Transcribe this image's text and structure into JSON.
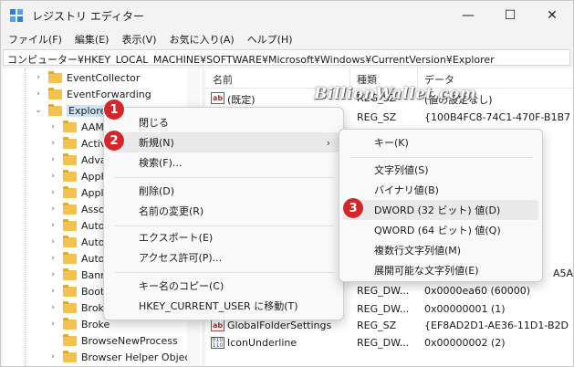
{
  "window": {
    "title": "レジストリ エディター",
    "controls": {
      "minimize": "—",
      "maximize": "☐",
      "close": "✕"
    }
  },
  "menubar": [
    "ファイル(F)",
    "編集(E)",
    "表示(V)",
    "お気に入り(A)",
    "ヘルプ(H)"
  ],
  "address": "コンピューター¥HKEY_LOCAL_MACHINE¥SOFTWARE¥Microsoft¥Windows¥CurrentVersion¥Explorer",
  "tree": {
    "items": [
      {
        "label": "EventCollector",
        "expanded": false,
        "selected": false
      },
      {
        "label": "EventForwarding",
        "expanded": false,
        "selected": false
      },
      {
        "label": "Explorer",
        "expanded": true,
        "selected": true
      },
      {
        "label": "AAM",
        "expanded": false,
        "selected": false
      },
      {
        "label": "Activ",
        "expanded": false,
        "selected": false
      },
      {
        "label": "Adva",
        "expanded": false,
        "selected": false
      },
      {
        "label": "AppK",
        "expanded": false,
        "selected": false
      },
      {
        "label": "Appl",
        "expanded": false,
        "selected": false
      },
      {
        "label": "Asso",
        "expanded": false,
        "selected": false
      },
      {
        "label": "Auto",
        "expanded": false,
        "selected": false
      },
      {
        "label": "Auto",
        "expanded": false,
        "selected": false
      },
      {
        "label": "Auto",
        "expanded": false,
        "selected": false
      },
      {
        "label": "Bann",
        "expanded": false,
        "selected": false
      },
      {
        "label": "Boot",
        "expanded": false,
        "selected": false
      },
      {
        "label": "Broke",
        "expanded": false,
        "selected": false
      },
      {
        "label": "Broke",
        "expanded": false,
        "selected": false
      },
      {
        "label": "BrowseNewProcess",
        "expanded": false,
        "selected": false
      },
      {
        "label": "Browser Helper Objec",
        "expanded": false,
        "selected": false
      }
    ]
  },
  "list": {
    "headers": {
      "name": "名前",
      "type": "種類",
      "data": "データ"
    },
    "rows": [
      {
        "icon": "ab",
        "name": "(既定)",
        "type": "REG_SZ",
        "data": "(値の設定なし)"
      },
      {
        "icon": "ab",
        "name": "",
        "type": "REG_SZ",
        "data": "{100B4FC8-74C1-470F-B1B7"
      },
      {
        "icon": "bin",
        "name": "",
        "type": "",
        "data": "A5A"
      },
      {
        "icon": "bin",
        "name": "",
        "type": "REG_DW...",
        "data": "0x0000ea60 (60000)"
      },
      {
        "icon": "bin",
        "name": "",
        "type": "REG_DW...",
        "data": "0x00000001 (1)"
      },
      {
        "icon": "ab",
        "name": "GlobalFolderSettings",
        "type": "REG_SZ",
        "data": "{EF8AD2D1-AE36-11D1-B2D"
      },
      {
        "icon": "bin",
        "name": "IconUnderline",
        "type": "REG_DW...",
        "data": "0x00000002 (2)"
      }
    ]
  },
  "watermark": "BillionWallet.com",
  "context_menu": {
    "items": [
      "閉じる",
      "新規(N)",
      "検索(F)...",
      "削除(D)",
      "名前の変更(R)",
      "エクスポート(E)",
      "アクセス許可(P)...",
      "キー名のコピー(C)",
      "HKEY_CURRENT_USER に移動(T)"
    ],
    "submenu_arrow": "›"
  },
  "submenu": {
    "items": [
      "キー(K)",
      "文字列値(S)",
      "バイナリ値(B)",
      "DWORD (32 ビット) 値(D)",
      "QWORD (64 ビット) 値(Q)",
      "複数行文字列値(M)",
      "展開可能な文字列値(E)"
    ]
  },
  "badges": [
    "1",
    "2",
    "3"
  ],
  "colors": {
    "badge": "#d7262b",
    "folder": "#f2c14e",
    "selection": "#cce4f7",
    "app_icon": "#2d7fd3"
  }
}
